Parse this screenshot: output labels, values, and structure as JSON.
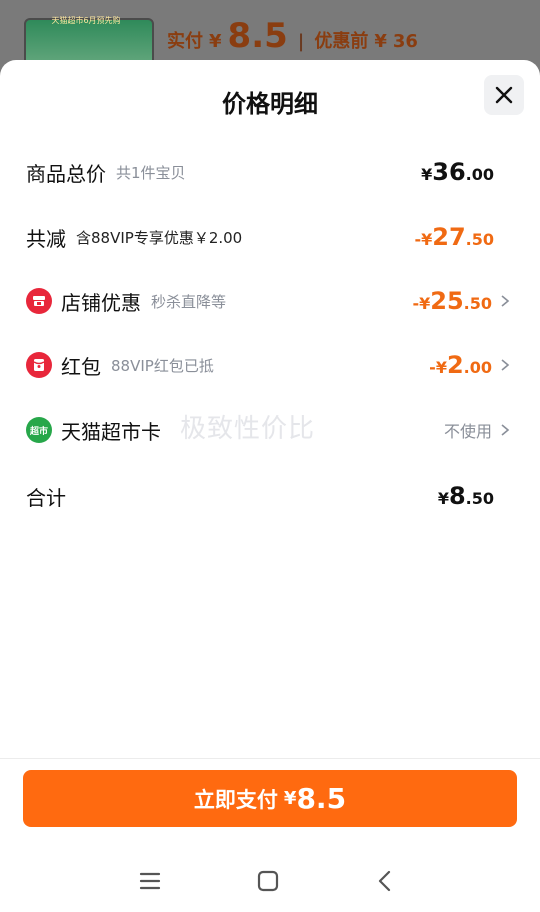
{
  "background": {
    "thumb_caption": "天猫超市6月预先购",
    "paid_label": "实付",
    "paid_currency": "¥",
    "paid_value": "8.5",
    "original_label": "优惠前",
    "original_currency": "¥",
    "original_value": "36"
  },
  "sheet": {
    "title": "价格明细",
    "rows": {
      "total": {
        "label": "商品总价",
        "sub": "共1件宝贝",
        "currency": "¥",
        "int": "36",
        "dec": ".00"
      },
      "discount": {
        "label": "共减",
        "sub": "含88VIP专享优惠￥2.00",
        "currency": "-¥",
        "int": "27",
        "dec": ".50"
      },
      "store": {
        "label": "店铺优惠",
        "sub": "秒杀直降等",
        "currency": "-¥",
        "int": "25",
        "dec": ".50"
      },
      "redpacket": {
        "label": "红包",
        "sub": "88VIP红包已抵",
        "currency": "-¥",
        "int": "2",
        "dec": ".00"
      },
      "tmall_card": {
        "label": "天猫超市卡",
        "icon_text": "超市",
        "value": "不使用"
      },
      "sum": {
        "label": "合计",
        "currency": "¥",
        "int": "8",
        "dec": ".50"
      }
    },
    "watermark": "极致性价比"
  },
  "pay_button": {
    "label": "立即支付",
    "currency": "¥",
    "value": "8.5"
  },
  "colors": {
    "accent": "#ff6a10",
    "discount": "#f06a13",
    "store_icon": "#e8273b",
    "card_icon": "#27a74a"
  },
  "icons": [
    "close-icon",
    "store-icon",
    "red-packet-icon",
    "supermarket-card-icon",
    "chevron-right-icon",
    "menu-icon",
    "home-icon",
    "back-icon"
  ]
}
